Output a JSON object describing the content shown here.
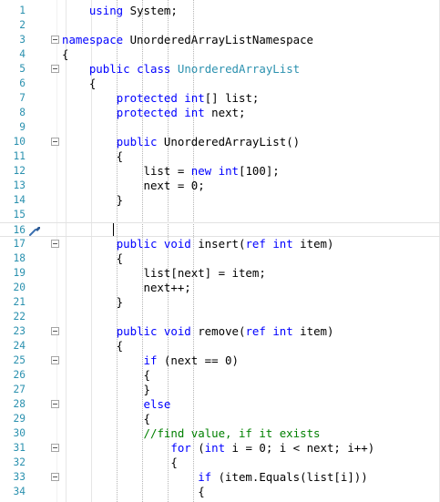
{
  "editor": {
    "lines": [
      {
        "n": "1",
        "fold": false,
        "parts": [
          {
            "t": "    "
          },
          {
            "t": "using",
            "c": "kw"
          },
          {
            "t": " System;"
          }
        ]
      },
      {
        "n": "2",
        "fold": false,
        "parts": []
      },
      {
        "n": "3",
        "fold": true,
        "parts": [
          {
            "t": "namespace",
            "c": "kw"
          },
          {
            "t": " UnorderedArrayListNamespace"
          }
        ]
      },
      {
        "n": "4",
        "fold": false,
        "parts": [
          {
            "t": "{"
          }
        ]
      },
      {
        "n": "5",
        "fold": true,
        "parts": [
          {
            "t": "    "
          },
          {
            "t": "public",
            "c": "kw"
          },
          {
            "t": " "
          },
          {
            "t": "class",
            "c": "kw"
          },
          {
            "t": " "
          },
          {
            "t": "UnorderedArrayList",
            "c": "ty"
          }
        ]
      },
      {
        "n": "6",
        "fold": false,
        "parts": [
          {
            "t": "    {"
          }
        ]
      },
      {
        "n": "7",
        "fold": false,
        "parts": [
          {
            "t": "        "
          },
          {
            "t": "protected",
            "c": "kw"
          },
          {
            "t": " "
          },
          {
            "t": "int",
            "c": "kw"
          },
          {
            "t": "[] list;"
          }
        ]
      },
      {
        "n": "8",
        "fold": false,
        "parts": [
          {
            "t": "        "
          },
          {
            "t": "protected",
            "c": "kw"
          },
          {
            "t": " "
          },
          {
            "t": "int",
            "c": "kw"
          },
          {
            "t": " next;"
          }
        ]
      },
      {
        "n": "9",
        "fold": false,
        "parts": []
      },
      {
        "n": "10",
        "fold": true,
        "parts": [
          {
            "t": "        "
          },
          {
            "t": "public",
            "c": "kw"
          },
          {
            "t": " UnorderedArrayList()"
          }
        ]
      },
      {
        "n": "11",
        "fold": false,
        "parts": [
          {
            "t": "        {"
          }
        ]
      },
      {
        "n": "12",
        "fold": false,
        "parts": [
          {
            "t": "            list = "
          },
          {
            "t": "new",
            "c": "kw"
          },
          {
            "t": " "
          },
          {
            "t": "int",
            "c": "kw"
          },
          {
            "t": "[100];"
          }
        ]
      },
      {
        "n": "13",
        "fold": false,
        "parts": [
          {
            "t": "            next = 0;"
          }
        ]
      },
      {
        "n": "14",
        "fold": false,
        "parts": [
          {
            "t": "        }"
          }
        ]
      },
      {
        "n": "15",
        "fold": false,
        "parts": []
      },
      {
        "n": "16",
        "fold": false,
        "parts": [],
        "current": true,
        "quick_action": "screwdriver-icon"
      },
      {
        "n": "17",
        "fold": true,
        "parts": [
          {
            "t": "        "
          },
          {
            "t": "public",
            "c": "kw"
          },
          {
            "t": " "
          },
          {
            "t": "void",
            "c": "kw"
          },
          {
            "t": " insert("
          },
          {
            "t": "ref",
            "c": "kw"
          },
          {
            "t": " "
          },
          {
            "t": "int",
            "c": "kw"
          },
          {
            "t": " item)"
          }
        ]
      },
      {
        "n": "18",
        "fold": false,
        "parts": [
          {
            "t": "        {"
          }
        ]
      },
      {
        "n": "19",
        "fold": false,
        "parts": [
          {
            "t": "            list[next] = item;"
          }
        ]
      },
      {
        "n": "20",
        "fold": false,
        "parts": [
          {
            "t": "            next++;"
          }
        ]
      },
      {
        "n": "21",
        "fold": false,
        "parts": [
          {
            "t": "        }"
          }
        ]
      },
      {
        "n": "22",
        "fold": false,
        "parts": []
      },
      {
        "n": "23",
        "fold": true,
        "parts": [
          {
            "t": "        "
          },
          {
            "t": "public",
            "c": "kw"
          },
          {
            "t": " "
          },
          {
            "t": "void",
            "c": "kw"
          },
          {
            "t": " remove("
          },
          {
            "t": "ref",
            "c": "kw"
          },
          {
            "t": " "
          },
          {
            "t": "int",
            "c": "kw"
          },
          {
            "t": " item)"
          }
        ]
      },
      {
        "n": "24",
        "fold": false,
        "parts": [
          {
            "t": "        {"
          }
        ]
      },
      {
        "n": "25",
        "fold": true,
        "parts": [
          {
            "t": "            "
          },
          {
            "t": "if",
            "c": "kw"
          },
          {
            "t": " (next == 0)"
          }
        ]
      },
      {
        "n": "26",
        "fold": false,
        "parts": [
          {
            "t": "            {"
          }
        ]
      },
      {
        "n": "27",
        "fold": false,
        "parts": [
          {
            "t": "            }"
          }
        ]
      },
      {
        "n": "28",
        "fold": true,
        "parts": [
          {
            "t": "            "
          },
          {
            "t": "else",
            "c": "kw"
          }
        ]
      },
      {
        "n": "29",
        "fold": false,
        "parts": [
          {
            "t": "            {"
          }
        ]
      },
      {
        "n": "30",
        "fold": false,
        "parts": [
          {
            "t": "            "
          },
          {
            "t": "//find value, if it exists",
            "c": "cm"
          }
        ]
      },
      {
        "n": "31",
        "fold": true,
        "parts": [
          {
            "t": "                "
          },
          {
            "t": "for",
            "c": "kw"
          },
          {
            "t": " ("
          },
          {
            "t": "int",
            "c": "kw"
          },
          {
            "t": " i = 0; i < next; i++)"
          }
        ]
      },
      {
        "n": "32",
        "fold": false,
        "parts": [
          {
            "t": "                {"
          }
        ]
      },
      {
        "n": "33",
        "fold": true,
        "parts": [
          {
            "t": "                    "
          },
          {
            "t": "if",
            "c": "kw"
          },
          {
            "t": " (item.Equals(list[i]))"
          }
        ]
      },
      {
        "n": "34",
        "fold": false,
        "parts": [
          {
            "t": "                    {"
          }
        ]
      }
    ]
  }
}
